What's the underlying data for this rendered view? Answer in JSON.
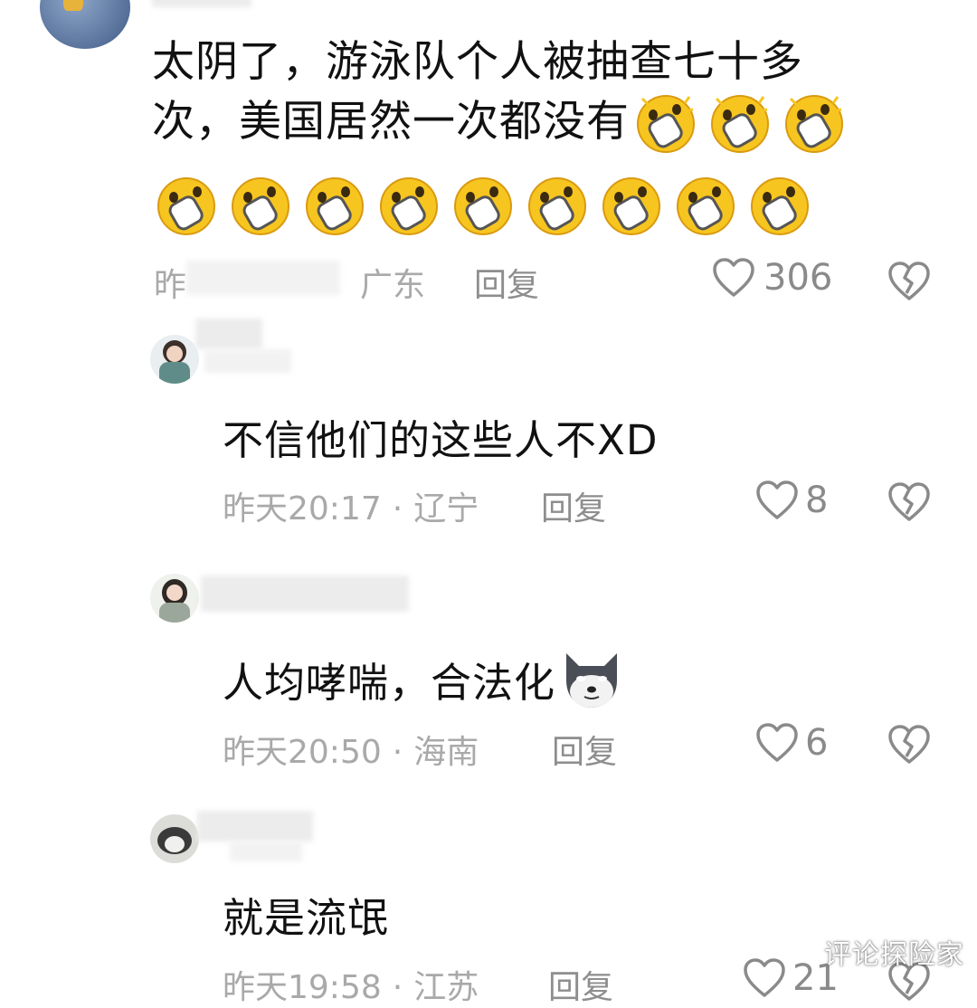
{
  "comments": [
    {
      "username": "",
      "text_line1": "太阴了，游泳队个人被抽查七十多",
      "text_line2": "次，美国居然一次都没有",
      "emoji_name": "shocked-face-emoji",
      "time": "昨",
      "location": "广东",
      "reply_label": "回复",
      "likes": "306"
    },
    {
      "username": "",
      "text": "不信他们的这些人不XD",
      "time": "昨天20:17",
      "separator": "·",
      "location": "辽宁",
      "reply_label": "回复",
      "likes": "8"
    },
    {
      "username": "",
      "text": "人均哮喘，合法化",
      "emoji_name": "husky-dog-emoji",
      "time": "昨天20:50",
      "separator": "·",
      "location": "海南",
      "reply_label": "回复",
      "likes": "6"
    },
    {
      "username": "",
      "text": "就是流氓",
      "time": "昨天19:58",
      "separator": "·",
      "location": "江苏",
      "reply_label": "回复",
      "likes": "21"
    }
  ],
  "watermark": "评论探险家",
  "colors": {
    "meta": "#a9a9a9",
    "emoji_yellow": "#f7c51f"
  }
}
